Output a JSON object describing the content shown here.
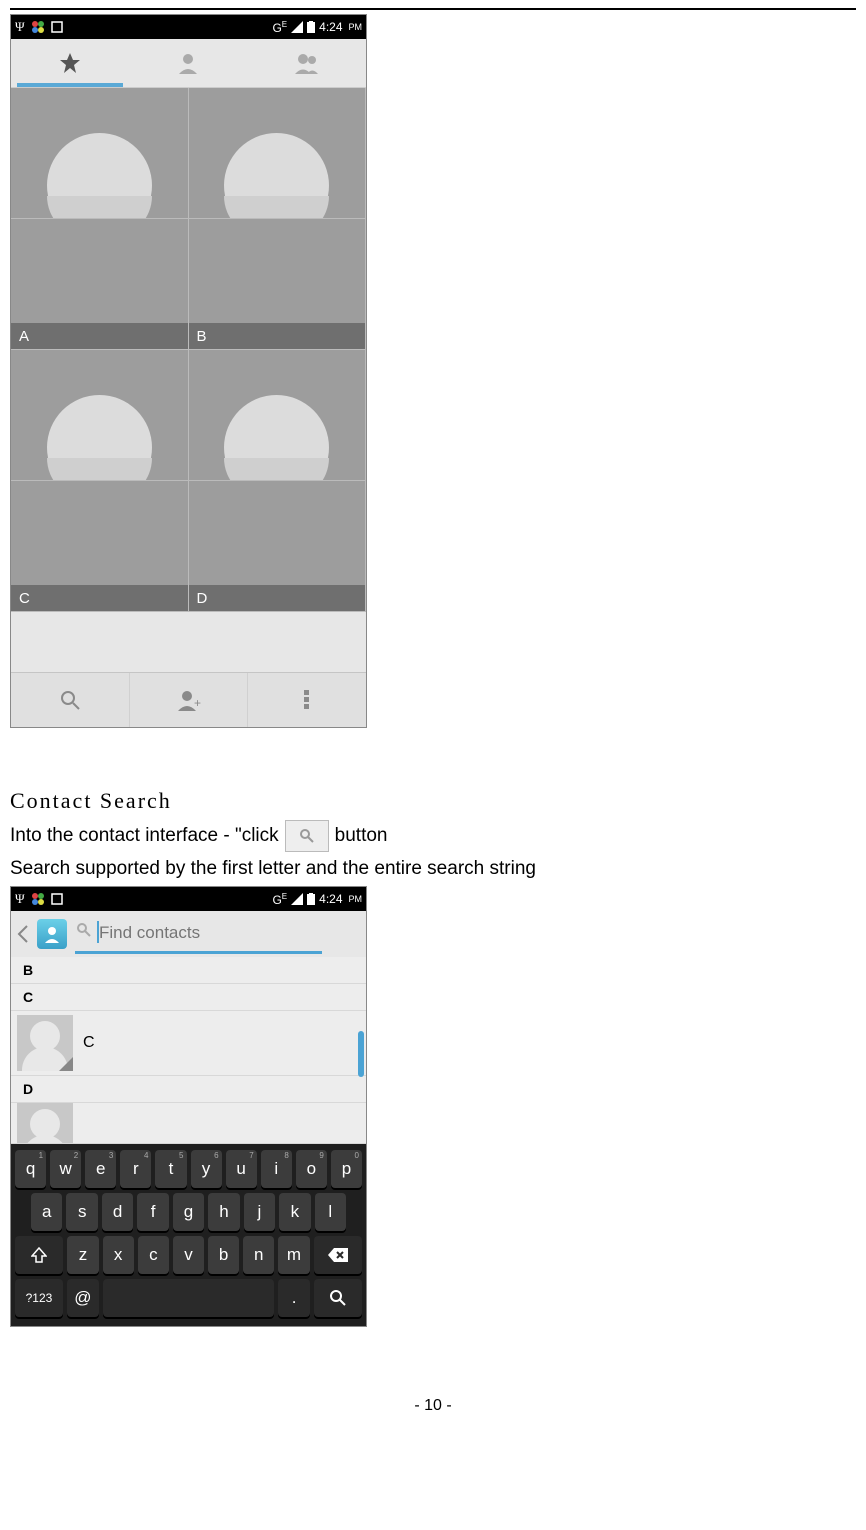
{
  "statusbar": {
    "network_label": "G",
    "network_sub": "E",
    "time": "4:24",
    "ampm": "PM"
  },
  "contacts_grid": {
    "cells": [
      {
        "name": ""
      },
      {
        "name": ""
      },
      {
        "name": "A"
      },
      {
        "name": "B"
      },
      {
        "name": ""
      },
      {
        "name": ""
      },
      {
        "name": "C"
      },
      {
        "name": "D"
      }
    ]
  },
  "section": {
    "heading": "Contact Search",
    "line1_a": "Into the contact interface - \"click",
    "line1_b": "button",
    "line2": "Search supported by the first letter and the entire search string"
  },
  "search_screen": {
    "placeholder": "Find contacts",
    "headers": [
      "B",
      "C",
      "D"
    ],
    "visible_contact": "C"
  },
  "keyboard": {
    "row1": [
      {
        "k": "q",
        "n": "1"
      },
      {
        "k": "w",
        "n": "2"
      },
      {
        "k": "e",
        "n": "3"
      },
      {
        "k": "r",
        "n": "4"
      },
      {
        "k": "t",
        "n": "5"
      },
      {
        "k": "y",
        "n": "6"
      },
      {
        "k": "u",
        "n": "7"
      },
      {
        "k": "i",
        "n": "8"
      },
      {
        "k": "o",
        "n": "9"
      },
      {
        "k": "p",
        "n": "0"
      }
    ],
    "row2": [
      {
        "k": "a"
      },
      {
        "k": "s"
      },
      {
        "k": "d"
      },
      {
        "k": "f"
      },
      {
        "k": "g"
      },
      {
        "k": "h"
      },
      {
        "k": "j"
      },
      {
        "k": "k"
      },
      {
        "k": "l"
      }
    ],
    "row3": [
      {
        "k": "z"
      },
      {
        "k": "x"
      },
      {
        "k": "c"
      },
      {
        "k": "v"
      },
      {
        "k": "b"
      },
      {
        "k": "n"
      },
      {
        "k": "m"
      }
    ],
    "sym": "?123",
    "at": "@",
    "dot": "."
  },
  "footer": "- 10 -"
}
